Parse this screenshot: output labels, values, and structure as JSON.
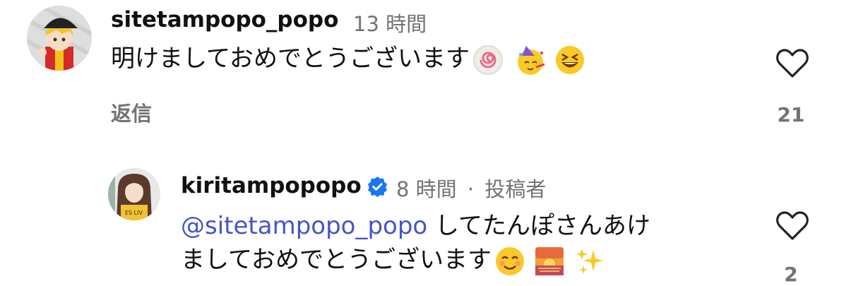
{
  "comments": [
    {
      "username": "sitetampopo_popo",
      "time": "13 時間",
      "text": "明けましておめでとうございます",
      "emojis": [
        "naruto-emoji",
        "partying-face-emoji",
        "grinning-squinting-face-emoji"
      ],
      "reply_label": "返信",
      "like_count": "21"
    },
    {
      "username": "kiritampopopo",
      "verified": true,
      "time": "8 時間",
      "separator": "·",
      "author_badge": "投稿者",
      "mention": "@sitetampopo_popo",
      "text_line1": " してたんぽさんあけ",
      "text_line2": "ましておめでとうございます",
      "emojis": [
        "smiling-face-emoji",
        "sunrise-emoji",
        "sparkles-emoji"
      ],
      "like_count": "2"
    }
  ],
  "colors": {
    "mention": "#4654c9",
    "meta": "#737373",
    "verified": "#1877f2"
  }
}
